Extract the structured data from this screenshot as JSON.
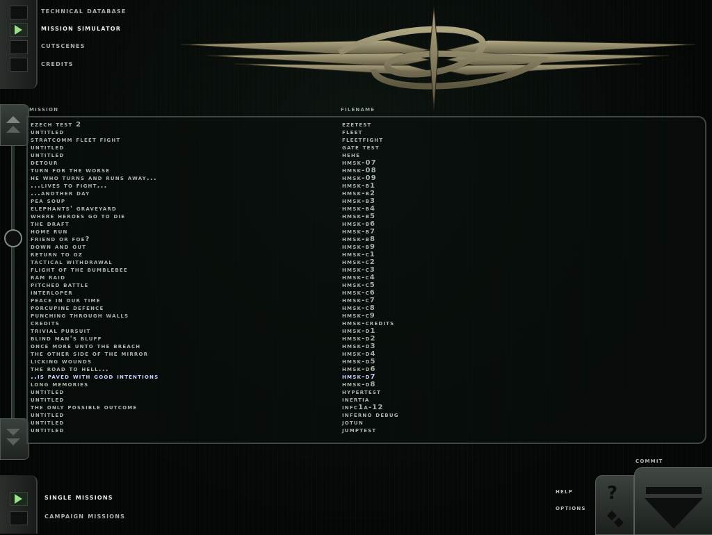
{
  "top_nav": {
    "items": [
      {
        "label": "Technical Database",
        "active": false
      },
      {
        "label": "Mission Simulator",
        "active": true
      },
      {
        "label": "Cutscenes",
        "active": false
      },
      {
        "label": "Credits",
        "active": false
      }
    ]
  },
  "columns": {
    "mission": "Mission",
    "filename": "Filename"
  },
  "missions": [
    {
      "mission": "Ezech Test 2",
      "filename": "eZeTest"
    },
    {
      "mission": "Untitled",
      "filename": "fleet"
    },
    {
      "mission": "StratComm Fleet Fight",
      "filename": "fleetfight"
    },
    {
      "mission": "Untitled",
      "filename": "gate test"
    },
    {
      "mission": "Untitled",
      "filename": "Hehe"
    },
    {
      "mission": "Detour",
      "filename": "Hmsk-07"
    },
    {
      "mission": "Turn for the Worse",
      "filename": "Hmsk-08"
    },
    {
      "mission": "He who turns and runs away...",
      "filename": "Hmsk-09"
    },
    {
      "mission": "...lives to fight...",
      "filename": "Hmsk-B1"
    },
    {
      "mission": "...another day",
      "filename": "Hmsk-B2"
    },
    {
      "mission": "Pea Soup",
      "filename": "Hmsk-B3"
    },
    {
      "mission": "Elephants' Graveyard",
      "filename": "Hmsk-B4"
    },
    {
      "mission": "Where Heroes Go To Die",
      "filename": "Hmsk-B5"
    },
    {
      "mission": "The Draft",
      "filename": "Hmsk-B6"
    },
    {
      "mission": "Home Run",
      "filename": "Hmsk-B7"
    },
    {
      "mission": "Friend or Foe?",
      "filename": "Hmsk-B8"
    },
    {
      "mission": "Down and Out",
      "filename": "Hmsk-B9"
    },
    {
      "mission": "Return to Oz",
      "filename": "Hmsk-C1"
    },
    {
      "mission": "Tactical Withdrawal",
      "filename": "Hmsk-C2"
    },
    {
      "mission": "Flight of the Bumblebee",
      "filename": "Hmsk-C3"
    },
    {
      "mission": "Ram Raid",
      "filename": "Hmsk-C4"
    },
    {
      "mission": "Pitched Battle",
      "filename": "Hmsk-C5"
    },
    {
      "mission": "Interloper",
      "filename": "Hmsk-C6"
    },
    {
      "mission": "Peace in our Time",
      "filename": "Hmsk-C7"
    },
    {
      "mission": "Porcupine Defence",
      "filename": "Hmsk-C8"
    },
    {
      "mission": "Punching Through Walls",
      "filename": "Hmsk-C9"
    },
    {
      "mission": "Credits",
      "filename": "Hmsk-Credits"
    },
    {
      "mission": "Trivial Pursuit",
      "filename": "Hmsk-D1"
    },
    {
      "mission": "Blind Man's Bluff",
      "filename": "Hmsk-D2"
    },
    {
      "mission": "Once More Unto the Breach",
      "filename": "Hmsk-D3"
    },
    {
      "mission": "The Other Side of the Mirror",
      "filename": "Hmsk-D4"
    },
    {
      "mission": "Licking Wounds",
      "filename": "Hmsk-D5"
    },
    {
      "mission": "The Road to Hell...",
      "filename": "Hmsk-D6"
    },
    {
      "mission": "..is paved with good intentions",
      "filename": "Hmsk-D7",
      "selected": true
    },
    {
      "mission": "Long Memories",
      "filename": "Hmsk-D8"
    },
    {
      "mission": "Untitled",
      "filename": "HyperTest"
    },
    {
      "mission": "Untitled",
      "filename": "inertia"
    },
    {
      "mission": "The only possible outcome",
      "filename": "INFC1A-12"
    },
    {
      "mission": "Untitled",
      "filename": "Inferno Debug"
    },
    {
      "mission": "Untitled",
      "filename": "Jotun"
    },
    {
      "mission": "Untitled",
      "filename": "jumptest"
    }
  ],
  "bottom_nav": {
    "items": [
      {
        "label": "Single Missions",
        "active": true
      },
      {
        "label": "Campaign Missions",
        "active": false
      }
    ]
  },
  "controls": {
    "commit": "Commit",
    "help": "Help",
    "options": "Options"
  },
  "colors": {
    "accent_arrow": "#9de08a",
    "selected_text": "#c8d2ff",
    "emblem": "#8a8266"
  }
}
